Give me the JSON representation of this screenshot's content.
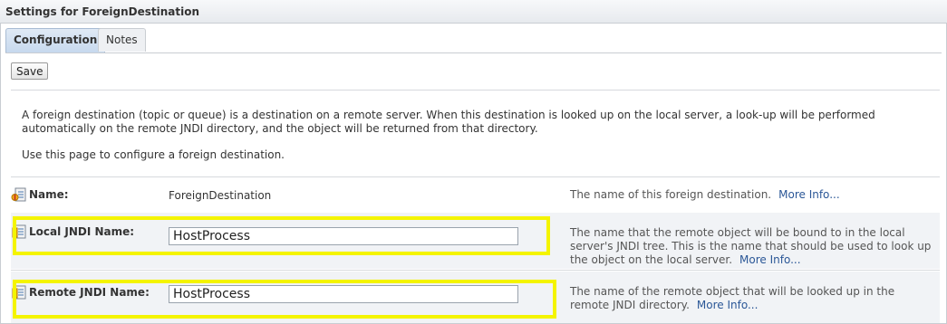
{
  "window": {
    "title": "Settings for ForeignDestination"
  },
  "tabs": [
    {
      "label": "Configuration",
      "active": true
    },
    {
      "label": "Notes",
      "active": false
    }
  ],
  "toolbar": {
    "save_label": "Save"
  },
  "description": {
    "paragraph1": "A foreign destination (topic or queue) is a destination on a remote server. When this destination is looked up on the local server, a look-up will be performed automatically on the remote JNDI directory, and the object will be returned from that directory.",
    "paragraph2": "Use this page to configure a foreign destination."
  },
  "fields": {
    "name": {
      "label": "Name:",
      "value": "ForeignDestination",
      "help": "The name of this foreign destination.",
      "more_info": "More Info..."
    },
    "local_jndi": {
      "label": "Local JNDI Name:",
      "value": "HostProcess",
      "help": "The name that the remote object will be bound to in the local server's JNDI tree. This is the name that should be used to look up the object on the local server.",
      "more_info": "More Info..."
    },
    "remote_jndi": {
      "label": "Remote JNDI Name:",
      "value": "HostProcess",
      "help": "The name of the remote object that will be looked up in the remote JNDI directory.",
      "more_info": "More Info..."
    }
  },
  "icons": {
    "name_icon": "property-key-icon",
    "field_icon": "property-icon"
  },
  "colors": {
    "highlight": "#f4f400",
    "link": "#2b5797",
    "active_tab": "#c7d9ee"
  }
}
